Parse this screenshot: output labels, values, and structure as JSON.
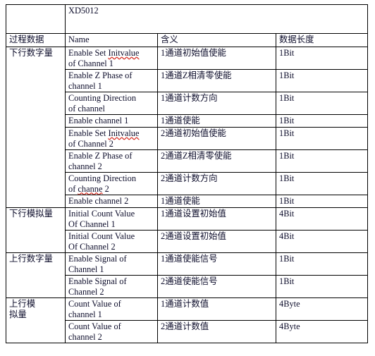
{
  "document": {
    "title_cell": "XD5012",
    "blank_corner": ""
  },
  "table": {
    "header": {
      "group_label": "过程数据",
      "name": "Name",
      "meaning": "含义",
      "length": "数据长度"
    },
    "groups": [
      {
        "label": "下行数字量",
        "rows": [
          {
            "name_line1": "Enable Set ",
            "name_misspelled": "Initvalue",
            "name_line2": "of Channel 1",
            "meaning": "1通道初始值使能",
            "length": "1Bit",
            "lines": 2
          },
          {
            "name_line1": "Enable Z Phase of",
            "name_line2": "channel 1",
            "meaning": "1通道Z相清零使能",
            "length": "1Bit",
            "lines": 2
          },
          {
            "name_line1": "Counting Direction",
            "name_line2": "of channel",
            "meaning": "1通道计数方向",
            "length": "1Bit",
            "lines": 2
          },
          {
            "name_line1": "Enable channel 1",
            "name_line2": "",
            "meaning": "1通道使能",
            "length": "1Bit",
            "lines": 1
          },
          {
            "name_line1": "Enable Set ",
            "name_misspelled": "Initvalue",
            "name_line2": "of Channel 2",
            "meaning": "2通道初始值使能",
            "length": "1Bit",
            "lines": 2
          },
          {
            "name_line1": "Enable Z Phase of",
            "name_line2": "channel 2",
            "meaning": "2通道Z相清零使能",
            "length": "1Bit",
            "lines": 2
          },
          {
            "name_line1": "Counting Direction",
            "name_line2_prefix": "of ",
            "name_line2_misspelled": "channe",
            "name_line2_suffix": " 2",
            "meaning": "2通道计数方向",
            "length": "1Bit",
            "lines": 2
          },
          {
            "name_line1": "Enable channel 2",
            "name_line2": "",
            "meaning": "1通道使能",
            "length": "1Bit",
            "lines": 1
          }
        ]
      },
      {
        "label": "下行模拟量",
        "rows": [
          {
            "name_line1": "Initial Count Value",
            "name_line2": "Of Channel 1",
            "meaning": "1通道设置初始值",
            "length": "4Bit",
            "lines": 2
          },
          {
            "name_line1": "Initial Count Value",
            "name_line2": "Of Channel 2",
            "meaning": "2通道设置初始值",
            "length": "4Bit",
            "lines": 2
          }
        ]
      },
      {
        "label": "上行数字量",
        "rows": [
          {
            "name_line1": "Enable Signal of",
            "name_line2": "Channel 1",
            "meaning": "1通道使能信号",
            "length": "1Bit",
            "lines": 2
          },
          {
            "name_line1": "Enable Signal of",
            "name_line2": "Channel 2",
            "meaning": "2通道使能信号",
            "length": "1Bit",
            "lines": 2
          }
        ]
      },
      {
        "label": "上行模\n拟量",
        "label_line1": "上行模",
        "label_line2": "拟量",
        "rows": [
          {
            "name_line1": "Count Value of",
            "name_line2": "channel 1",
            "meaning": "1通道计数值",
            "length": "4Byte",
            "lines": 2
          },
          {
            "name_line1": "Count Value of",
            "name_line2": "channel 2",
            "meaning": "2通道计数值",
            "length": "4Byte",
            "lines": 2
          }
        ]
      }
    ]
  },
  "colors": {
    "border": "#000000",
    "text": "#0d0d2b",
    "spellcheck_underline": "#d93025",
    "background": "#ffffff"
  }
}
